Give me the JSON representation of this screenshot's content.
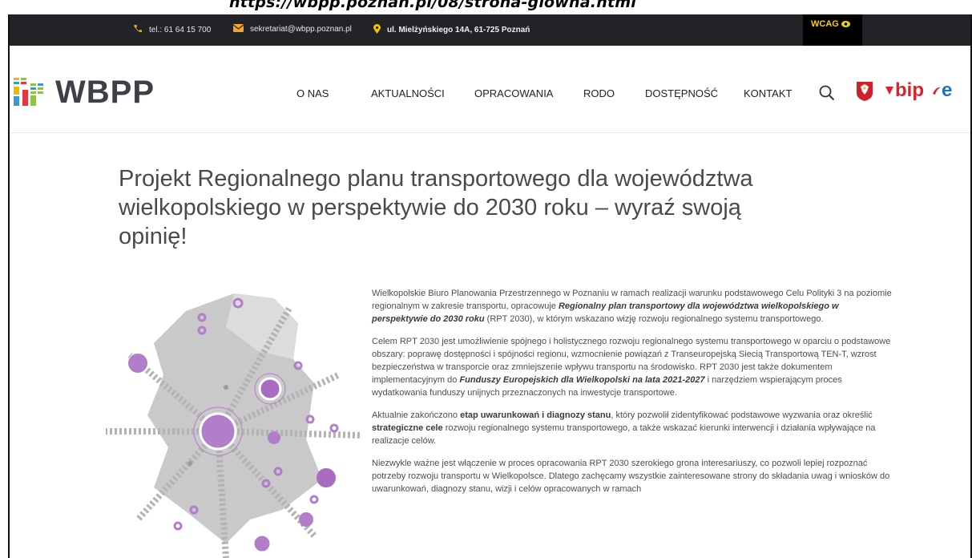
{
  "caption": "https://wbpp.poznan.pl/08/strona-glowna.html",
  "topbar": {
    "phone": "tel.: 61 64 15 700",
    "email": "sekretariat@wbpp.poznan.pl",
    "address": "ul. Mielżyńskiego 14A, 61-725 Poznań",
    "wcag": "WCAG",
    "icons": [
      "phone-icon",
      "mail-icon",
      "pin-icon",
      "eye-icon"
    ]
  },
  "logo": {
    "text": "WBPP"
  },
  "nav": {
    "items": [
      {
        "label": "O NAS"
      },
      {
        "label": "AKTUALNOŚCI"
      },
      {
        "label": "OPRACOWANIA"
      },
      {
        "label": "RODO"
      },
      {
        "label": "DOSTĘPNOŚĆ"
      },
      {
        "label": "KONTAKT"
      }
    ],
    "bip_label": "bip",
    "e_label": "e"
  },
  "article": {
    "title": "Projekt Regionalnego planu transportowego dla województwa wielkopolskiego w perspektywie do 2030 roku – wyraź swoją opinię!",
    "p1_a": "Wielkopolskie Biuro Planowania Przestrzennego w Poznaniu w ramach realizacji warunku podstawowego Celu Polityki 3 na poziomie regionalnym w zakresie transportu, opracowuje ",
    "p1_b": "Regionalny plan transportowy dla województwa wielkopolskiego w perspektywie do 2030 roku",
    "p1_c": " (RPT 2030), w którym wskazano wizję rozwoju regionalnego systemu transportowego.",
    "p2_a": "Celem RPT 2030 jest umożliwienie spójnego i holistycznego rozwoju regionalnego systemu transportowego w oparciu o podstawowe obszary: poprawę dostępności i spójności regionu, wzmocnienie powiązań z Transeuropejską Siecią Transportową TEN-T, wzrost bezpieczeństwa w transporcie oraz zmniejszenie wpływu transportu na środowisko. RPT 2030 jest także dokumentem implementacyjnym do ",
    "p2_b": "Funduszy Europejskich dla Wielkopolski na lata 2021-2027",
    "p2_c": " i narzędziem wspierającym proces wydatkowania funduszy unijnych przeznaczonych na inwestycje transportowe.",
    "p3_a": "Aktualnie zakończono ",
    "p3_b": "etap uwarunkowań i diagnozy stanu",
    "p3_c": ", który pozwolił zidentyfikować podstawowe wyzwania oraz określić ",
    "p3_d": "strategiczne cele",
    "p3_e": " rozwoju regionalnego systemu transportowego, a także wskazać kierunki interwencji i działania wpływające na realizacje celów.",
    "p4": "Niezwykle ważne jest włączenie w proces opracowania RPT 2030 szerokiego grona interesariuszy, co pozwoli lepiej rozpoznać potrzeby rozwoju transportu w Wielkopolsce. Dlatego zachęcamy wszystkie zainteresowane strony do składania uwag i wniosków do uwarunkowań, diagnozy stanu, wizji i celów opracowanych w ramach"
  },
  "colors": {
    "topbar_bg": "#222326",
    "accent_purple": "#a87dc4",
    "wcag_yellow": "#f5d300",
    "bip_red": "#d9232d"
  }
}
